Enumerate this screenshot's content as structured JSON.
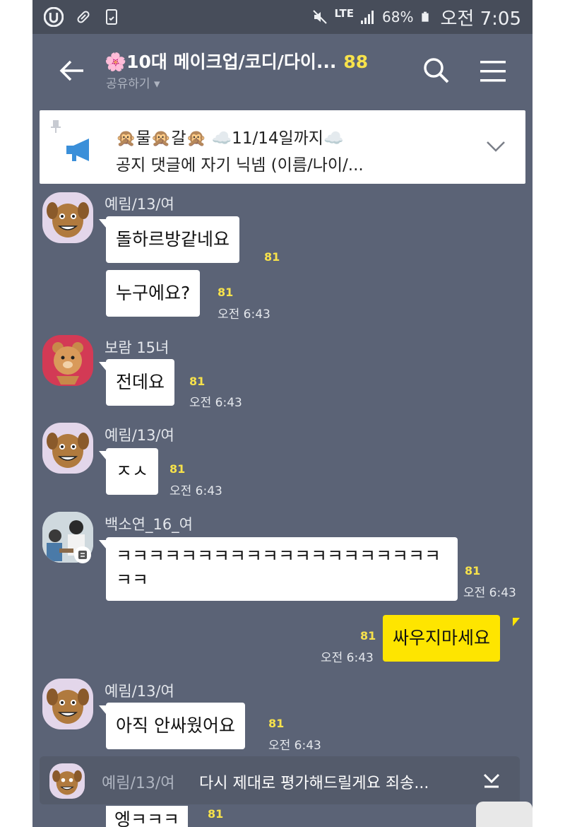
{
  "status_bar": {
    "network": "LTE",
    "battery": "68%",
    "time": "오전 7:05",
    "icons": [
      "u-plus-icon",
      "pill-icon",
      "phone-check-icon",
      "mute-icon",
      "signal-icon",
      "battery-icon"
    ]
  },
  "header": {
    "title": "🌸10대 메이크업/코디/다이...",
    "member_count": "88",
    "subtitle": "공유하기 ▾"
  },
  "notice": {
    "line1": "🙊물🙊갈🙊 ☁️11/14일까지☁️",
    "line2": "공지 댓글에 자기 닉넴 (이름/나이/..."
  },
  "messages": [
    {
      "sender": "예림/13/여",
      "text": "돌하르방같네요",
      "unread": "81",
      "time": ""
    },
    {
      "sender": "",
      "text": "누구에요?",
      "unread": "81",
      "time": "오전 6:43"
    },
    {
      "sender": "보람 15녀",
      "text": "전데요",
      "unread": "81",
      "time": "오전 6:43"
    },
    {
      "sender": "예림/13/여",
      "text": "ㅈㅅ",
      "unread": "81",
      "time": "오전 6:43"
    },
    {
      "sender": "백소연_16_여",
      "text_line1": "ㅋㅋㅋㅋㅋㅋㅋㅋㅋㅋㅋㅋㅋㅋㅋㅋㅋㅋㅋㅋ",
      "text_line2": "ㅋㅋ",
      "unread": "81",
      "time": "오전 6:43"
    },
    {
      "sender": "me",
      "text": "싸우지마세요",
      "unread": "81",
      "time": "오전 6:43"
    },
    {
      "sender": "예림/13/여",
      "text": "아직 안싸웠어요",
      "unread": "81",
      "time": "오전 6:43"
    }
  ],
  "preview": {
    "name": "예림/13/여",
    "text": "다시 제대로 평가해드릴게요 죄송..."
  },
  "partial_message": {
    "text": "엥ㅋㅋㅋ",
    "unread": "81"
  },
  "colors": {
    "chat_bg": "#5b6376",
    "my_bubble": "#fee500",
    "unread": "#f7e24b"
  }
}
